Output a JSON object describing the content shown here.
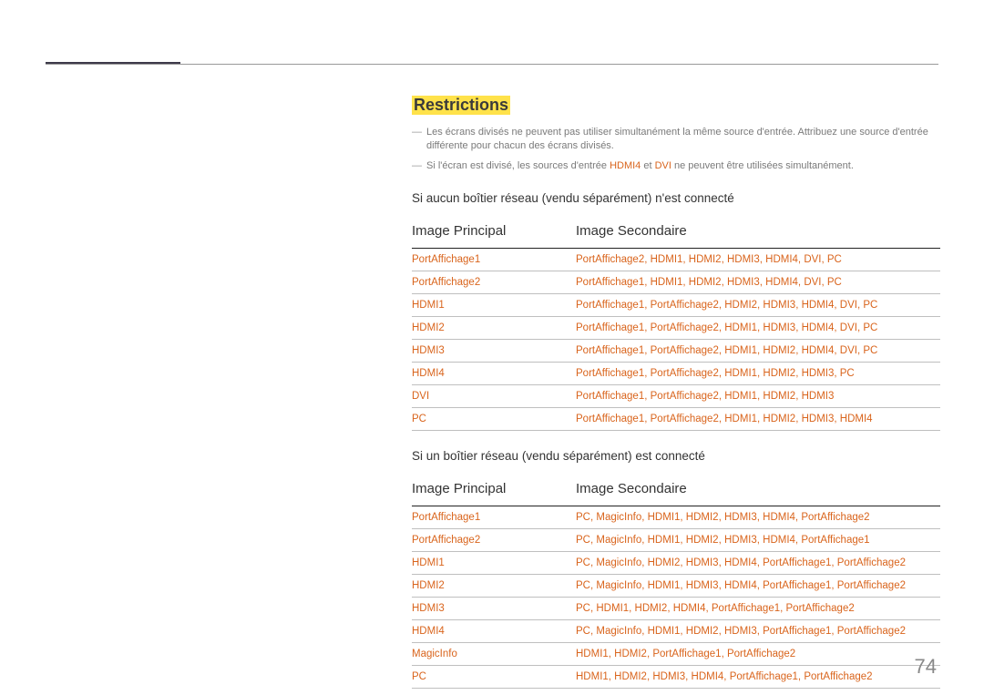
{
  "section_title": "Restrictions",
  "notes": [
    {
      "parts": [
        {
          "text": "Les écrans divisés ne peuvent pas utiliser simultanément la même source d'entrée. Attribuez une source d'entrée différente pour chacun des écrans divisés.",
          "hl": false
        }
      ]
    },
    {
      "parts": [
        {
          "text": "Si l'écran est divisé, les sources d'entrée ",
          "hl": false
        },
        {
          "text": "HDMI4",
          "hl": true
        },
        {
          "text": " et ",
          "hl": false
        },
        {
          "text": "DVI",
          "hl": true
        },
        {
          "text": " ne peuvent être utilisées simultanément.",
          "hl": false
        }
      ]
    }
  ],
  "table1": {
    "caption": "Si aucun boîtier réseau (vendu séparément) n'est connecté",
    "col1": "Image Principal",
    "col2": "Image Secondaire",
    "rows": [
      {
        "primary": "PortAffichage1",
        "secondary": [
          "PortAffichage2",
          "HDMI1",
          "HDMI2",
          "HDMI3",
          "HDMI4",
          "DVI",
          "PC"
        ]
      },
      {
        "primary": "PortAffichage2",
        "secondary": [
          "PortAffichage1",
          "HDMI1",
          "HDMI2",
          "HDMI3",
          "HDMI4",
          "DVI",
          "PC"
        ]
      },
      {
        "primary": "HDMI1",
        "secondary": [
          "PortAffichage1",
          "PortAffichage2",
          "HDMI2",
          "HDMI3",
          "HDMI4",
          "DVI",
          "PC"
        ]
      },
      {
        "primary": "HDMI2",
        "secondary": [
          "PortAffichage1",
          "PortAffichage2",
          "HDMI1",
          "HDMI3",
          "HDMI4",
          "DVI",
          "PC"
        ]
      },
      {
        "primary": "HDMI3",
        "secondary": [
          "PortAffichage1",
          "PortAffichage2",
          "HDMI1",
          "HDMI2",
          "HDMI4",
          "DVI",
          "PC"
        ]
      },
      {
        "primary": "HDMI4",
        "secondary": [
          "PortAffichage1",
          "PortAffichage2",
          "HDMI1",
          "HDMI2",
          "HDMI3",
          "PC"
        ]
      },
      {
        "primary": "DVI",
        "secondary": [
          "PortAffichage1",
          "PortAffichage2",
          "HDMI1",
          "HDMI2",
          "HDMI3"
        ]
      },
      {
        "primary": "PC",
        "secondary": [
          "PortAffichage1",
          "PortAffichage2",
          "HDMI1",
          "HDMI2",
          "HDMI3",
          "HDMI4"
        ]
      }
    ]
  },
  "table2": {
    "caption": "Si un boîtier réseau (vendu séparément) est connecté",
    "col1": "Image Principal",
    "col2": "Image Secondaire",
    "rows": [
      {
        "primary": "PortAffichage1",
        "secondary": [
          "PC",
          "MagicInfo",
          "HDMI1",
          "HDMI2",
          "HDMI3",
          "HDMI4",
          "PortAffichage2"
        ]
      },
      {
        "primary": "PortAffichage2",
        "secondary": [
          "PC",
          "MagicInfo",
          "HDMI1",
          "HDMI2",
          "HDMI3",
          "HDMI4",
          "PortAffichage1"
        ]
      },
      {
        "primary": "HDMI1",
        "secondary": [
          "PC",
          "MagicInfo",
          "HDMI2",
          "HDMI3",
          "HDMI4",
          "PortAffichage1",
          "PortAffichage2"
        ]
      },
      {
        "primary": "HDMI2",
        "secondary": [
          "PC",
          "MagicInfo",
          "HDMI1",
          "HDMI3",
          "HDMI4",
          "PortAffichage1",
          "PortAffichage2"
        ]
      },
      {
        "primary": "HDMI3",
        "secondary": [
          "PC",
          "HDMI1",
          "HDMI2",
          "HDMI4",
          "PortAffichage1",
          "PortAffichage2"
        ]
      },
      {
        "primary": "HDMI4",
        "secondary": [
          "PC",
          "MagicInfo",
          "HDMI1",
          "HDMI2",
          "HDMI3",
          "PortAffichage1",
          "PortAffichage2"
        ]
      },
      {
        "primary": "MagicInfo",
        "secondary": [
          "HDMI1",
          "HDMI2",
          "PortAffichage1",
          "PortAffichage2"
        ]
      },
      {
        "primary": "PC",
        "secondary": [
          "HDMI1",
          "HDMI2",
          "HDMI3",
          "HDMI4",
          "PortAffichage1",
          "PortAffichage2"
        ]
      }
    ]
  },
  "page_number": "74"
}
